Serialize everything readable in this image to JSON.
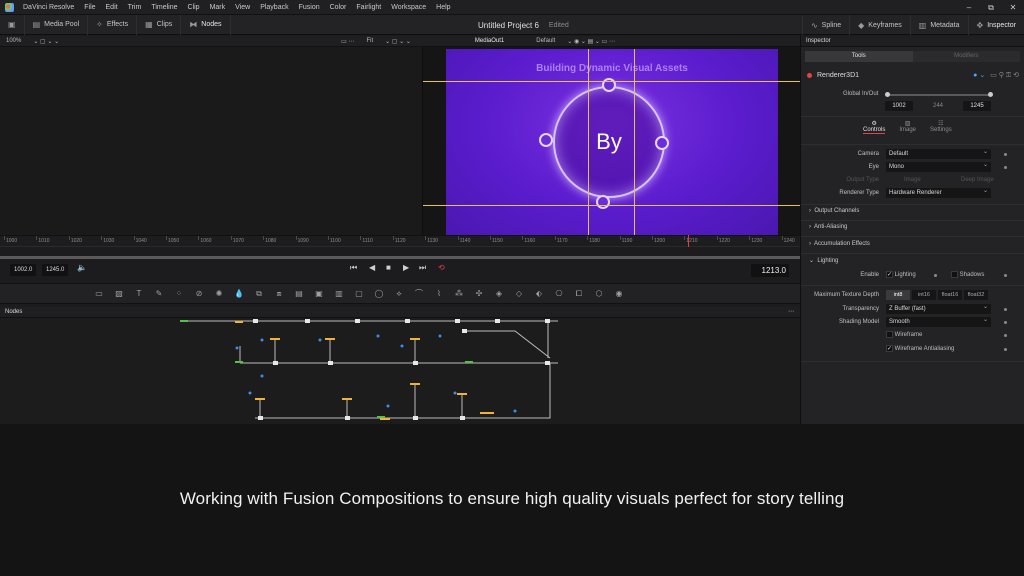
{
  "menubar": {
    "app_name": "DaVinci Resolve",
    "items": [
      "File",
      "Edit",
      "Trim",
      "Timeline",
      "Clip",
      "Mark",
      "View",
      "Playback",
      "Fusion",
      "Color",
      "Fairlight",
      "Workspace",
      "Help"
    ]
  },
  "toolbar": {
    "media_pool": "Media Pool",
    "effects": "Effects",
    "clips": "Clips",
    "nodes": "Nodes",
    "project_title": "Untitled Project 6",
    "project_status": "Edited",
    "spline": "Spline",
    "keyframes": "Keyframes",
    "metadata": "Metadata",
    "inspector": "Inspector"
  },
  "viewer": {
    "left_zoom": "100%",
    "right_fit": "Fit",
    "output_name": "MediaOut1",
    "lut": "Default",
    "preview_title": "Building Dynamic Visual Assets",
    "preview_text": "By"
  },
  "ruler": {
    "labels": [
      "1000",
      "1010",
      "1020",
      "1030",
      "1040",
      "1050",
      "1060",
      "1070",
      "1080",
      "1090",
      "1100",
      "1110",
      "1120",
      "1130",
      "1140",
      "1150",
      "1160",
      "1170",
      "1180",
      "1190",
      "1200",
      "1210",
      "1220",
      "1230",
      "1240"
    ],
    "playhead_frame": 1213
  },
  "transport": {
    "in_point": "1002.0",
    "out_point": "1245.0",
    "current_frame": "1213.0"
  },
  "nodes_panel": {
    "title": "Nodes"
  },
  "inspector": {
    "title": "Inspector",
    "tab_tools": "Tools",
    "tab_modifiers": "Modifiers",
    "node_name": "Renderer3D1",
    "global_in_out_label": "Global In/Out",
    "global_in": "1002",
    "global_mid": "244",
    "global_out": "1245",
    "subtab_controls": "Controls",
    "subtab_image": "Image",
    "subtab_settings": "Settings",
    "camera_label": "Camera",
    "camera_value": "Default",
    "eye_label": "Eye",
    "eye_value": "Mono",
    "output_type_label": "Output Type",
    "output_type_image": "Image",
    "output_type_depth": "Deep Image",
    "renderer_type_label": "Renderer Type",
    "renderer_type_value": "Hardware Renderer",
    "section_output_channels": "Output Channels",
    "section_anti_aliasing": "Anti-Aliasing",
    "section_accumulation": "Accumulation Effects",
    "section_lighting": "Lighting",
    "enable_label": "Enable",
    "lighting_label": "Lighting",
    "shadows_label": "Shadows",
    "max_tex_depth_label": "Maximum Texture Depth",
    "tex_depth_options": [
      "int8",
      "int16",
      "float16",
      "float32"
    ],
    "tex_depth_selected": "int8",
    "transparency_label": "Transparency",
    "transparency_value": "Z Buffer (fast)",
    "shading_label": "Shading Model",
    "shading_value": "Smooth",
    "wireframe_label": "Wireframe",
    "wireframe_aa_label": "Wireframe Antialiasing"
  },
  "caption": "Working with Fusion Compositions to ensure high quality visuals perfect for story telling",
  "colors": {
    "accent_red": "#e04646",
    "guide_yellow": "#e7c447",
    "preview_purple": "#5a1ccd"
  }
}
